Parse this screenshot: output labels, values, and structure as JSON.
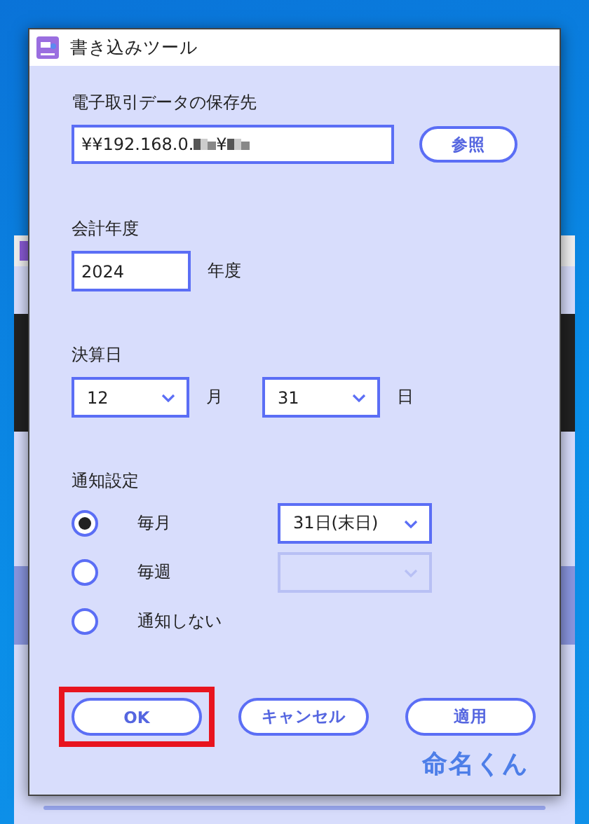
{
  "window": {
    "title": "書き込みツール"
  },
  "storage": {
    "label": "電子取引データの保存先",
    "path_parts": [
      {
        "kind": "text",
        "text": "¥¥192.168.0."
      },
      {
        "kind": "mask"
      },
      {
        "kind": "text",
        "text": "¥"
      },
      {
        "kind": "mask"
      }
    ],
    "browse_button": "参照"
  },
  "fiscal_year": {
    "label": "会計年度",
    "value": "2024",
    "unit": "年度"
  },
  "closing_date": {
    "label": "決算日",
    "month": "12",
    "month_unit": "月",
    "day": "31",
    "day_unit": "日"
  },
  "notification": {
    "label": "通知設定",
    "options": [
      {
        "label": "毎月",
        "selected": true,
        "dropdown": {
          "value": "31日(末日)",
          "disabled": false
        }
      },
      {
        "label": "毎週",
        "selected": false,
        "dropdown": {
          "disabled": true
        }
      },
      {
        "label": "通知しない",
        "selected": false
      }
    ]
  },
  "buttons": [
    {
      "label": "OK",
      "highlighted": true
    },
    {
      "label": "キャンセル",
      "highlighted": false
    },
    {
      "label": "適用",
      "highlighted": false
    }
  ],
  "logo": "命名くん"
}
